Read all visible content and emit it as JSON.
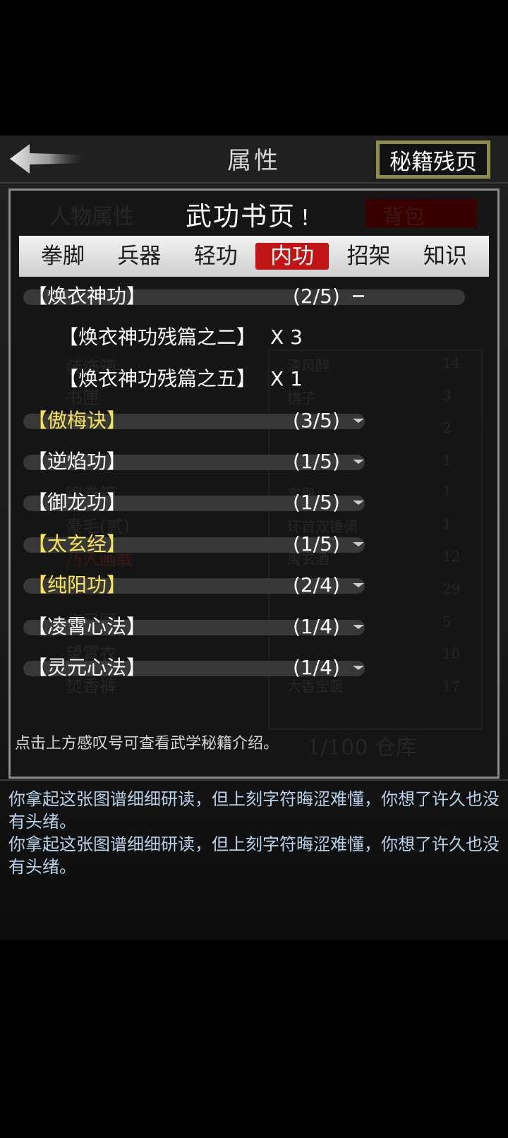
{
  "header": {
    "title": "属性",
    "secret_button": "秘籍残页",
    "back_icon": "back-arrow-icon"
  },
  "panel": {
    "title": "武功书页",
    "info_mark": "！",
    "background_labels": {
      "left_tab": "人物属性",
      "right_tab": "背包",
      "col_left": [
        "装饰箱",
        "书匣",
        "锦卷箱",
        "豪毛(贰)",
        "乃人画载",
        "临风图",
        "望霄衣",
        "焚香裤"
      ],
      "col_right": [
        "清风醉",
        "棋子",
        "宫殿",
        "环首双锤佩",
        "周玄酒",
        "大香宝篋"
      ],
      "numbers": [
        "14",
        "3",
        "2",
        "1",
        "1",
        "1",
        "12",
        "29",
        "5",
        "10",
        "17"
      ],
      "storage": "1/100 仓库"
    },
    "tabs": [
      {
        "label": "拳脚",
        "active": false
      },
      {
        "label": "兵器",
        "active": false
      },
      {
        "label": "轻功",
        "active": false
      },
      {
        "label": "内功",
        "active": true
      },
      {
        "label": "招架",
        "active": false
      },
      {
        "label": "知识",
        "active": false
      }
    ],
    "skills": [
      {
        "name": "【焕衣神功】",
        "count": "(2/5)",
        "gold": false,
        "expanded": true,
        "pages": [
          {
            "name": "【焕衣神功残篇之二】",
            "qty": "X 3"
          },
          {
            "name": "【焕衣神功残篇之五】",
            "qty": "X 1"
          }
        ]
      },
      {
        "name": "【傲梅诀】",
        "count": "(3/5)",
        "gold": true
      },
      {
        "name": "【逆焰功】",
        "count": "(1/5)",
        "gold": false
      },
      {
        "name": "【御龙功】",
        "count": "(1/5)",
        "gold": false
      },
      {
        "name": "【太玄经】",
        "count": "(1/5)",
        "gold": true
      },
      {
        "name": "【纯阳功】",
        "count": "(2/4)",
        "gold": true
      },
      {
        "name": "【凌霄心法】",
        "count": "(1/4)",
        "gold": false
      },
      {
        "name": "【灵元心法】",
        "count": "(1/4)",
        "gold": false
      }
    ],
    "hint": "点击上方感叹号可查看武学秘籍介绍。"
  },
  "log": [
    "你拿起这张图谱细细研读，但上刻字符晦涩难懂，你想了许久也没有头绪。",
    "你拿起这张图谱细细研读，但上刻字符晦涩难懂，你想了许久也没有头绪。"
  ],
  "colors": {
    "active_tab": "#c11414",
    "gold_text": "#f6e35c",
    "log_text": "#b8d2ea",
    "button_border": "#8c8c4c"
  }
}
